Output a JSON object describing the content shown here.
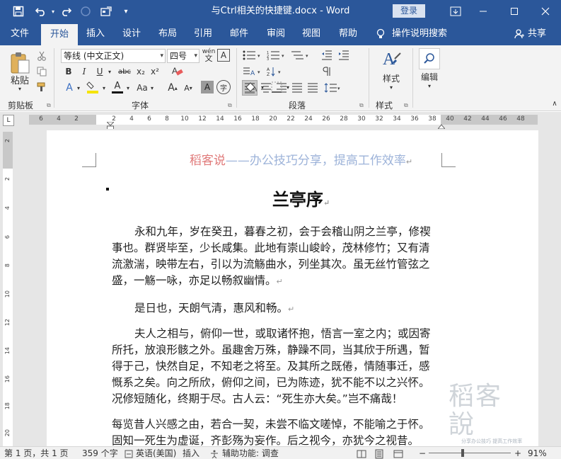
{
  "titlebar": {
    "doc_title": "与Ctrl相关的快捷键.docx - Word",
    "login": "登录",
    "icons": [
      "save-icon",
      "undo-icon",
      "redo-icon",
      "circle-icon",
      "form-icon",
      "customize-icon"
    ]
  },
  "tabs": [
    {
      "label": "文件"
    },
    {
      "label": "开始"
    },
    {
      "label": "插入"
    },
    {
      "label": "设计"
    },
    {
      "label": "布局"
    },
    {
      "label": "引用"
    },
    {
      "label": "邮件"
    },
    {
      "label": "审阅"
    },
    {
      "label": "视图"
    },
    {
      "label": "帮助"
    }
  ],
  "tell_me": "操作说明搜索",
  "share": "共享",
  "ribbon": {
    "paste": "粘贴",
    "clipboard": "剪贴板",
    "font_name": "等线 (中文正文)",
    "font_size": "四号",
    "wen": "wén",
    "font": "字体",
    "paragraph": "段落",
    "styles": "样式",
    "styles_group": "样式",
    "edit": "编辑",
    "b": "B",
    "i": "I",
    "u": "U",
    "abc": "abc",
    "x2": "x₂",
    "x2up": "x²",
    "a_case": "Aa",
    "a_grow": "A",
    "a_shrink": "A",
    "a_font_color": "A",
    "a_char_shade": "A",
    "wen_circle": "字",
    "clear_fmt": "A",
    "text_effect": "A",
    "wen_border": "A"
  },
  "ruler": {
    "ticks": [
      "6",
      "4",
      "2",
      "2",
      "4",
      "6",
      "8",
      "10",
      "12",
      "14",
      "16",
      "18",
      "20",
      "22",
      "24",
      "26",
      "28",
      "30",
      "32",
      "34",
      "36",
      "38",
      "40",
      "42",
      "44",
      "46",
      "48"
    ]
  },
  "vruler": {
    "ticks": [
      "2",
      "2",
      "4",
      "6",
      "8",
      "10",
      "12",
      "14",
      "16",
      "18",
      "20"
    ]
  },
  "document": {
    "header_hl": "稻客说",
    "header_rest": "——办公技巧分享，提高工作效率",
    "title": "兰亭序",
    "p1": "永和九年，岁在癸丑，暮春之初，会于会稽山阴之兰亭，修禊事也。群贤毕至，少长咸集。此地有崇山峻岭，茂林修竹；又有清流激湍，映带左右，引以为流觞曲水，列坐其次。虽无丝竹管弦之盛，一觞一咏，亦足以畅叙幽情。",
    "p2": "是日也，天朗气清，惠风和畅。",
    "p3": "夫人之相与，俯仰一世，或取诸怀抱，悟言一室之内；或因寄所托，放浪形骸之外。虽趣舍万殊，静躁不同，当其欣于所遇，暂得于己，快然自足，不知老之将至。及其所之既倦，情随事迁，感慨系之矣。向之所欣，俯仰之间，已为陈迹，犹不能不以之兴怀。况修短随化，终期于尽。古人云：“死生亦大矣。”岂不痛哉！",
    "p4": "每览昔人兴感之由，若合一契，未尝不临文嗟悼，不能喻之于怀。固知一死生为虚诞，齐彭殇为妄作。后之视今，亦犹今之视昔。",
    "para_mark": "↵"
  },
  "watermark": {
    "logo": "稻客說",
    "tagline": "分享办公技巧 提高工作效率"
  },
  "status": {
    "page": "第 1 页，共 1 页",
    "words": "359 个字",
    "lang": "英语(美国)",
    "mode": "插入",
    "access": "辅助功能: 调查",
    "zoom": "91%"
  }
}
